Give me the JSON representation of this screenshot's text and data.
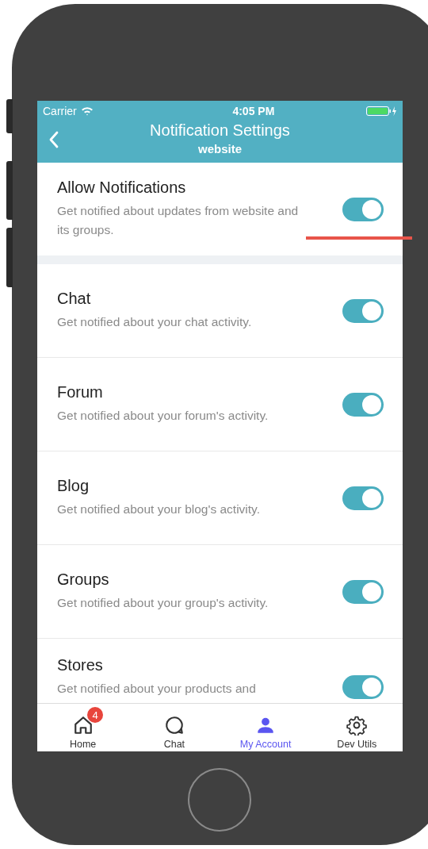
{
  "status_bar": {
    "carrier": "Carrier",
    "time": "4:05 PM"
  },
  "header": {
    "title": "Notification Settings",
    "subtitle": "website"
  },
  "master": {
    "title": "Allow Notifications",
    "description": "Get notified about updates from website and its groups.",
    "on": true
  },
  "settings": [
    {
      "title": "Chat",
      "description": "Get notified about your chat activity.",
      "on": true
    },
    {
      "title": "Forum",
      "description": "Get notified about your forum's activity.",
      "on": true
    },
    {
      "title": "Blog",
      "description": "Get notified about your blog's activity.",
      "on": true
    },
    {
      "title": "Groups",
      "description": "Get notified about your group's activity.",
      "on": true
    },
    {
      "title": "Stores",
      "description": "Get notified about your products and",
      "on": true
    }
  ],
  "tab_bar": [
    {
      "label": "Home",
      "badge": "4",
      "selected": false
    },
    {
      "label": "Chat",
      "selected": false
    },
    {
      "label": "My Account",
      "selected": true
    },
    {
      "label": "Dev Utils",
      "selected": false
    }
  ]
}
